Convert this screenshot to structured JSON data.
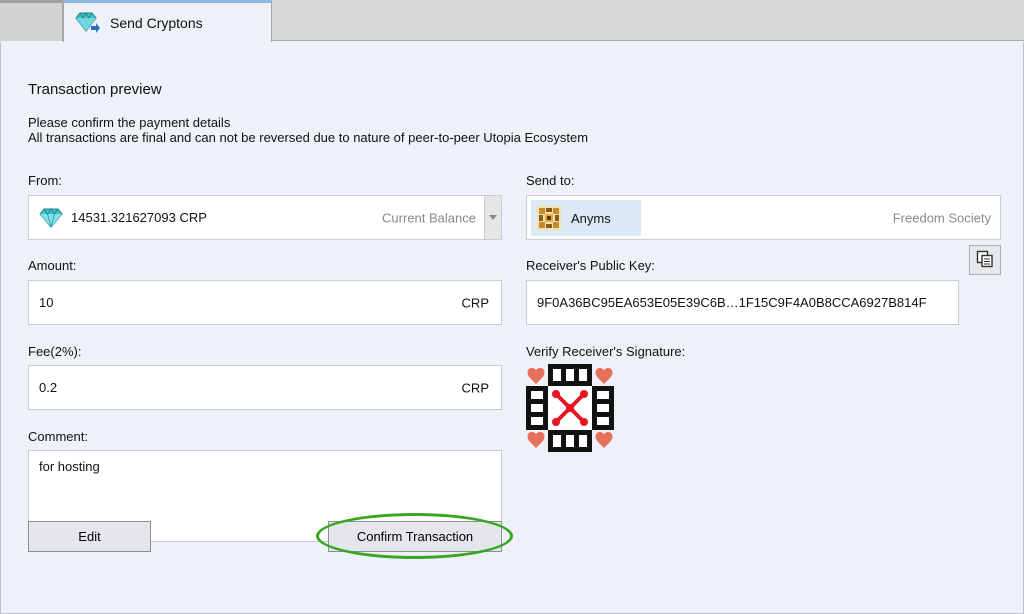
{
  "tab": {
    "label": "Send Cryptons",
    "icon": "crypton-send-icon"
  },
  "preview": {
    "title": "Transaction preview",
    "line1": "Please confirm the payment details",
    "line2": "All transactions are final and can not be reversed due to nature of peer-to-peer Utopia Ecosystem"
  },
  "from": {
    "label": "From:",
    "balance": "14531.321627093 CRP",
    "hint": "Current Balance",
    "icon": "crypton-gem-icon"
  },
  "amount": {
    "label": "Amount:",
    "value": "10",
    "unit": "CRP"
  },
  "fee": {
    "label": "Fee(2%):",
    "value": "0.2",
    "unit": "CRP"
  },
  "comment": {
    "label": "Comment:",
    "value": "for hosting"
  },
  "send_to": {
    "label": "Send to:",
    "contact": "Anyms",
    "group": "Freedom Society",
    "avatar_icon": "contact-avatar-icon"
  },
  "public_key": {
    "label": "Receiver's Public Key:",
    "value": "9F0A36BC95EA653E05E39C6B…1F15C9F4A0B8CCA6927B814F",
    "copy_icon": "copy-icon"
  },
  "signature": {
    "label": "Verify Receiver's Signature:",
    "icon": "signature-identicon"
  },
  "buttons": {
    "edit": "Edit",
    "confirm": "Confirm Transaction"
  },
  "colors": {
    "background": "#eef2f8",
    "tab_accent": "#8fb8e0",
    "highlight": "#3aa520",
    "gem": "#3fc1c9",
    "signature_red": "#e8141e",
    "signature_pink": "#e8705a"
  }
}
